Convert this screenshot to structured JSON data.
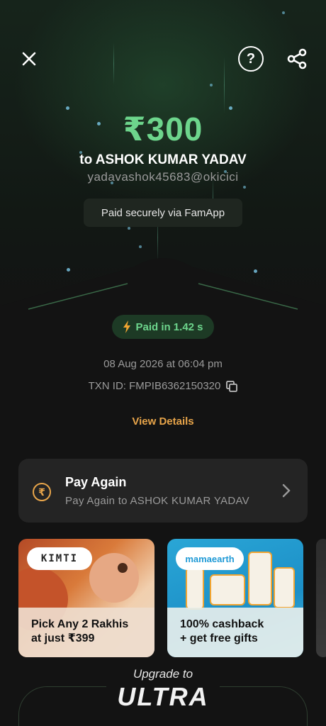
{
  "payment": {
    "amount": "₹300",
    "payee_line": "to ASHOK KUMAR YADAV",
    "upi_id": "yadavashok45683@okicici",
    "secure_text": "Paid securely via FamApp"
  },
  "details": {
    "paid_time": "Paid in 1.42 s",
    "datetime": "08 Aug 2026 at 06:04 pm",
    "txn_id": "TXN ID: FMPIB6362150320",
    "view_details": "View Details"
  },
  "pay_again": {
    "icon_glyph": "₹",
    "title": "Pay Again",
    "subtitle": "Pay Again to ASHOK KUMAR YADAV"
  },
  "offers": [
    {
      "brand": "KIMTI",
      "caption_line1": "Pick Any 2 Rakhis",
      "caption_line2": "at just ₹399"
    },
    {
      "brand": "mamaearth",
      "caption_line1": "100% cashback",
      "caption_line2": "+ get free gifts"
    }
  ],
  "upgrade": {
    "line": "Upgrade to",
    "brand": "ULTRA"
  },
  "colors": {
    "accent_green": "#6dd58c",
    "accent_orange": "#e8a54a",
    "background": "#131313"
  },
  "icons": [
    "close-icon",
    "help-icon",
    "share-icon",
    "bolt-icon",
    "copy-icon",
    "rupee-icon",
    "chevron-right-icon"
  ]
}
